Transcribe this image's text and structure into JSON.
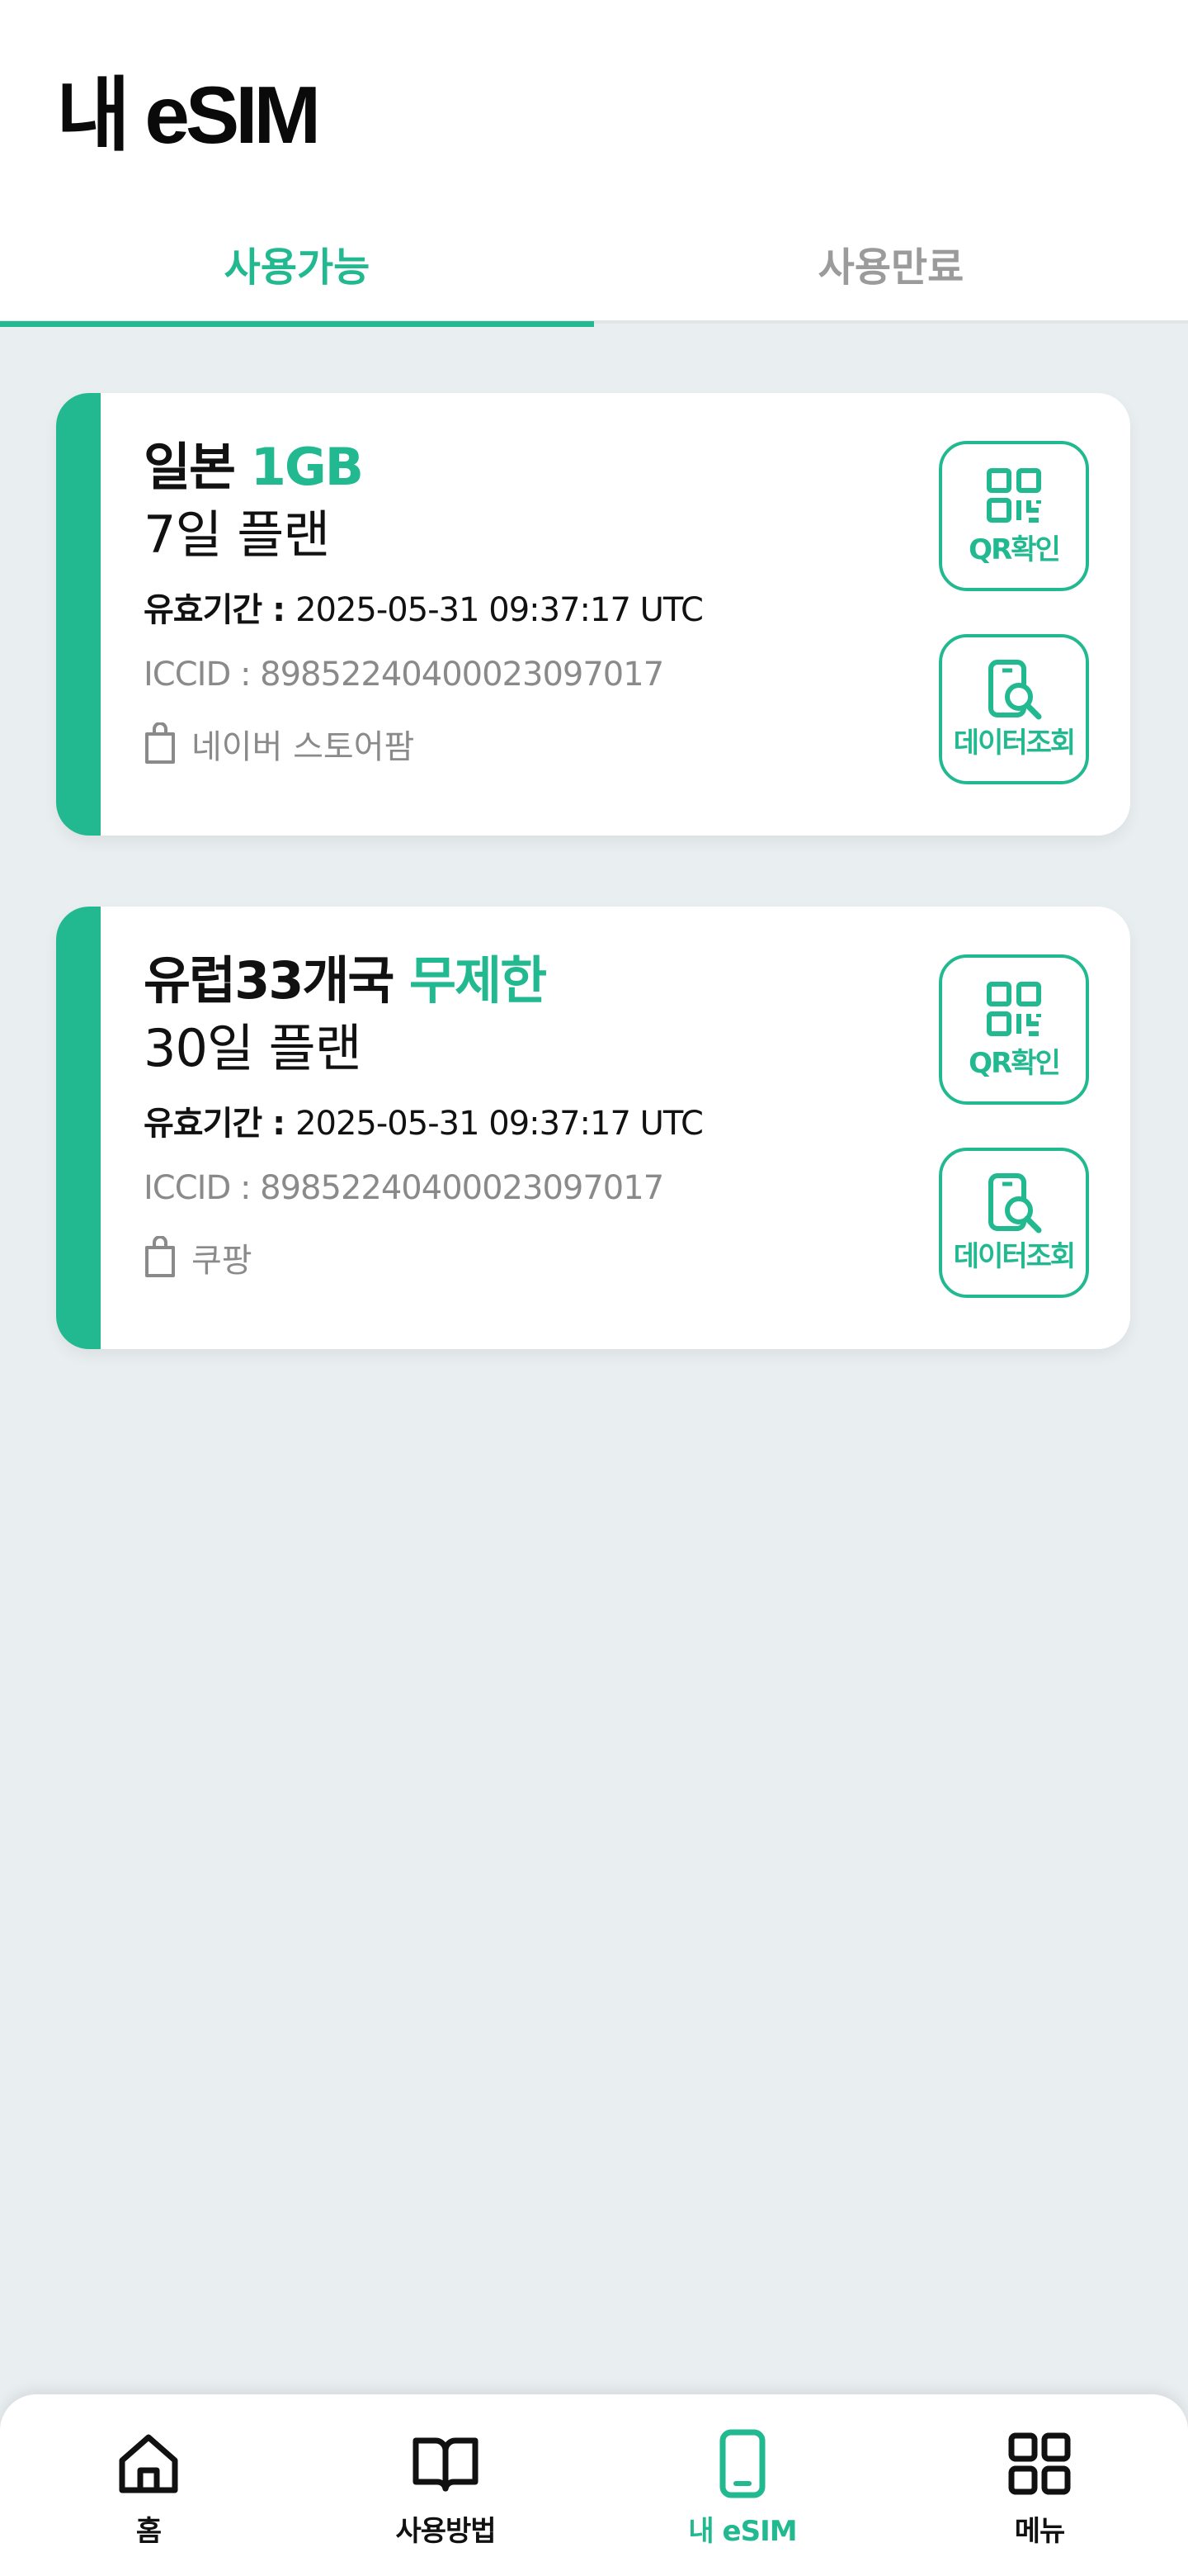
{
  "header": {
    "title": "내 eSIM",
    "tabs": [
      {
        "label": "사용가능",
        "active": true
      },
      {
        "label": "사용만료",
        "active": false
      }
    ]
  },
  "cards": [
    {
      "title_main": "일본",
      "title_accent": "1GB",
      "plan": "7일 플랜",
      "validity_label": "유효기간 : ",
      "validity_value": "2025-05-31 09:37:17 UTC",
      "iccid": "ICCID : 89852240400023097017",
      "store": "네이버 스토어팜",
      "qr_button": "QR확인",
      "data_button": "데이터조회"
    },
    {
      "title_main": "유럽33개국",
      "title_accent": "무제한",
      "plan": "30일 플랜",
      "validity_label": "유효기간 : ",
      "validity_value": "2025-05-31 09:37:17 UTC",
      "iccid": "ICCID : 89852240400023097017",
      "store": "쿠팡",
      "qr_button": "QR확인",
      "data_button": "데이터조회"
    }
  ],
  "bottom_nav": [
    {
      "label": "홈",
      "icon": "home-icon",
      "active": false
    },
    {
      "label": "사용방법",
      "icon": "book-icon",
      "active": false
    },
    {
      "label": "내 eSIM",
      "icon": "phone-icon",
      "active": true
    },
    {
      "label": "메뉴",
      "icon": "grid-icon",
      "active": false
    }
  ],
  "colors": {
    "accent": "#22b991",
    "background": "#e9eef1",
    "muted_text": "#8a8a8a",
    "inactive_tab": "#9b9b9b"
  }
}
